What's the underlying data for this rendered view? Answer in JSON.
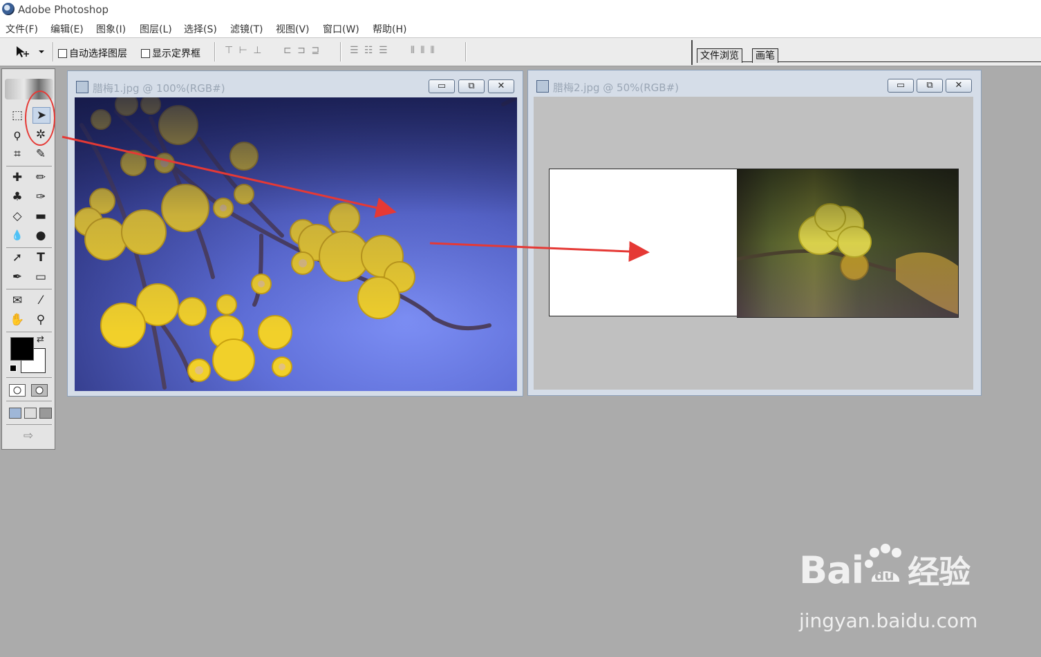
{
  "app": {
    "title": "Adobe Photoshop"
  },
  "menu": [
    "文件(F)",
    "编辑(E)",
    "图象(I)",
    "图层(L)",
    "选择(S)",
    "滤镜(T)",
    "视图(V)",
    "窗口(W)",
    "帮助(H)"
  ],
  "options": {
    "auto_select_label": "自动选择图层",
    "show_bounds_label": "显示定界框",
    "align_group_1": "⊤ ⊢ ⊥",
    "align_group_2": "⊏ ⊐ ⊒",
    "distribute_group_1": "☰ ☷ ☰",
    "distribute_group_2": "⫴ ⫴ ⫴"
  },
  "palette_well": {
    "tabs": [
      "文件浏览",
      "画笔"
    ]
  },
  "documents": [
    {
      "title": "腊梅1.jpg @ 100%(RGB#)"
    },
    {
      "title": "腊梅2.jpg @ 50%(RGB#)"
    }
  ],
  "window_buttons": {
    "minimize": "▭",
    "restore": "⧉",
    "close": "✕"
  },
  "tools": {
    "marquee": "⬚",
    "move": "➤",
    "lasso": "ϙ",
    "magic_wand": "✲",
    "crop": "⌗",
    "slice": "✎",
    "healing": "✚",
    "brush": "✏",
    "stamp": "♣",
    "history_brush": "✑",
    "eraser": "◇",
    "gradient": "▬",
    "blur": "💧",
    "dodge": "●",
    "path_select": "➚",
    "type": "T",
    "pen": "✒",
    "shape": "▭",
    "notes": "✉",
    "eyedropper": "⁄",
    "hand": "✋",
    "zoom": "⚲",
    "swap": "⇄",
    "jump": "⇨"
  },
  "watermark": {
    "brand": "Bai",
    "paw": "du",
    "chinese": "经验",
    "url": "jingyan.baidu.com"
  },
  "colors": {
    "annotation_red": "#e53935",
    "foreground": "#000000",
    "background": "#ffffff"
  }
}
